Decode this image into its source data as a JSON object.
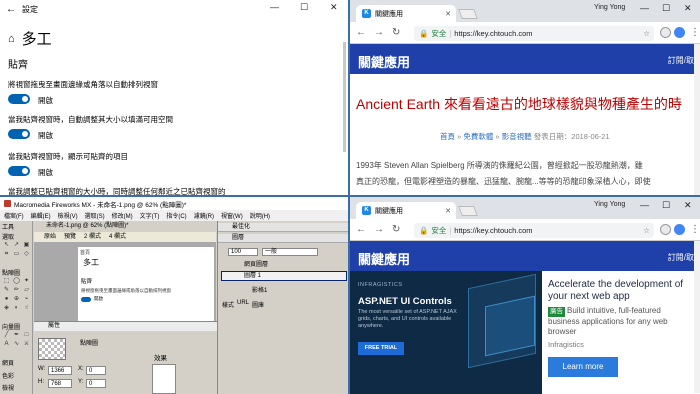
{
  "settings": {
    "window_title": "設定",
    "page_title": "多工",
    "section": "貼齊",
    "items": [
      {
        "label": "將視窗拖曳至畫面邊緣或角落以自動排列視窗",
        "state": "開啟"
      },
      {
        "label": "當我貼齊視窗時，自動調整其大小以填滿可用空間",
        "state": "開啟"
      },
      {
        "label": "當我貼齊視窗時，顯示可貼齊的項目",
        "state": "開啟"
      },
      {
        "label": "當我調整已貼齊視窗的大小時，同時調整任何鄰近之已貼齊視窗的",
        "state": ""
      }
    ],
    "window_controls": [
      "—",
      "☐",
      "✕"
    ]
  },
  "chrome": {
    "tab_title": "關鍵應用",
    "favicon": "K",
    "user": "Ying Yong",
    "security": "安全",
    "url": "https://key.chtouch.com",
    "window_controls": [
      "—",
      "☐",
      "✕"
    ]
  },
  "site": {
    "logo": "關鍵應用",
    "subscribe": "訂閱/取",
    "article_title": "Ancient Earth 來看看遠古的地球樣貌與物種產生的時",
    "meta_home": "首頁",
    "meta_sep": " » ",
    "meta_cat1": "免費軟體",
    "meta_cat2": "影音視聽",
    "meta_date": " 發表日期：2018-06-21",
    "body_line1": "1993年 Steven Allan Spielberg 所導演的侏羅紀公園，曾經掀起一股恐龍熱潮，雖",
    "body_line2": "真正的恐龍，但電影裡塑造的暴龍、迅猛龍、腕龍...等等的恐龍印象深植人心，即使"
  },
  "ad": {
    "brand": "INFRAGISTICS",
    "headline": "ASP.NET UI Controls",
    "text": "The most versatile set of ASP.NET AJAX grids, charts, and UI controls available anywhere.",
    "cta": "FREE TRIAL",
    "right_headline": "Accelerate the development of your next web app",
    "tag": "廣告",
    "right_text": "Build intuitive, full-featured business applications for any web browser",
    "source": "Infragistics",
    "right_cta": "Learn more"
  },
  "fireworks": {
    "title": "Macromedia Fireworks MX - 未命名-1.png @ 62% (點陣圖)*",
    "menu": [
      "檔案(F)",
      "編輯(E)",
      "檢視(V)",
      "選取(S)",
      "修改(M)",
      "文字(T)",
      "指令(C)",
      "濾鏡(R)",
      "視窗(W)",
      "說明(H)"
    ],
    "tools_label": "工具",
    "tool_groups": [
      "選取",
      "點陣圖",
      "向量圖",
      "網頁",
      "色彩",
      "檢視"
    ],
    "doc_tab": "未命名-1.png @ 62% (點陣圖)*",
    "doc_subtabs": [
      "原始",
      "預覽",
      "2 欄式",
      "4 欄式"
    ],
    "canvas": {
      "home": "首頁",
      "title": "多工",
      "section": "貼齊",
      "line": "將視窗拖曳至畫面邊緣或角落以自動排列視窗",
      "state": "開啟"
    },
    "panels": {
      "optimize": "最佳化",
      "layers": "圖層",
      "opacity": "100",
      "blend": "一般",
      "frames": "影格1"
    },
    "layers": [
      "網頁圖層",
      "圖層 1"
    ],
    "styles_tabs": [
      "樣式",
      "URL",
      "圖庫"
    ],
    "props_title": "屬性",
    "props_name": "點陣圖",
    "props_w": "1366",
    "props_h": "768",
    "props_x": "0",
    "props_y": "0",
    "props_effect": "效果",
    "label_w": "W:",
    "label_h": "H:",
    "label_x": "X:",
    "label_y": "Y:"
  }
}
